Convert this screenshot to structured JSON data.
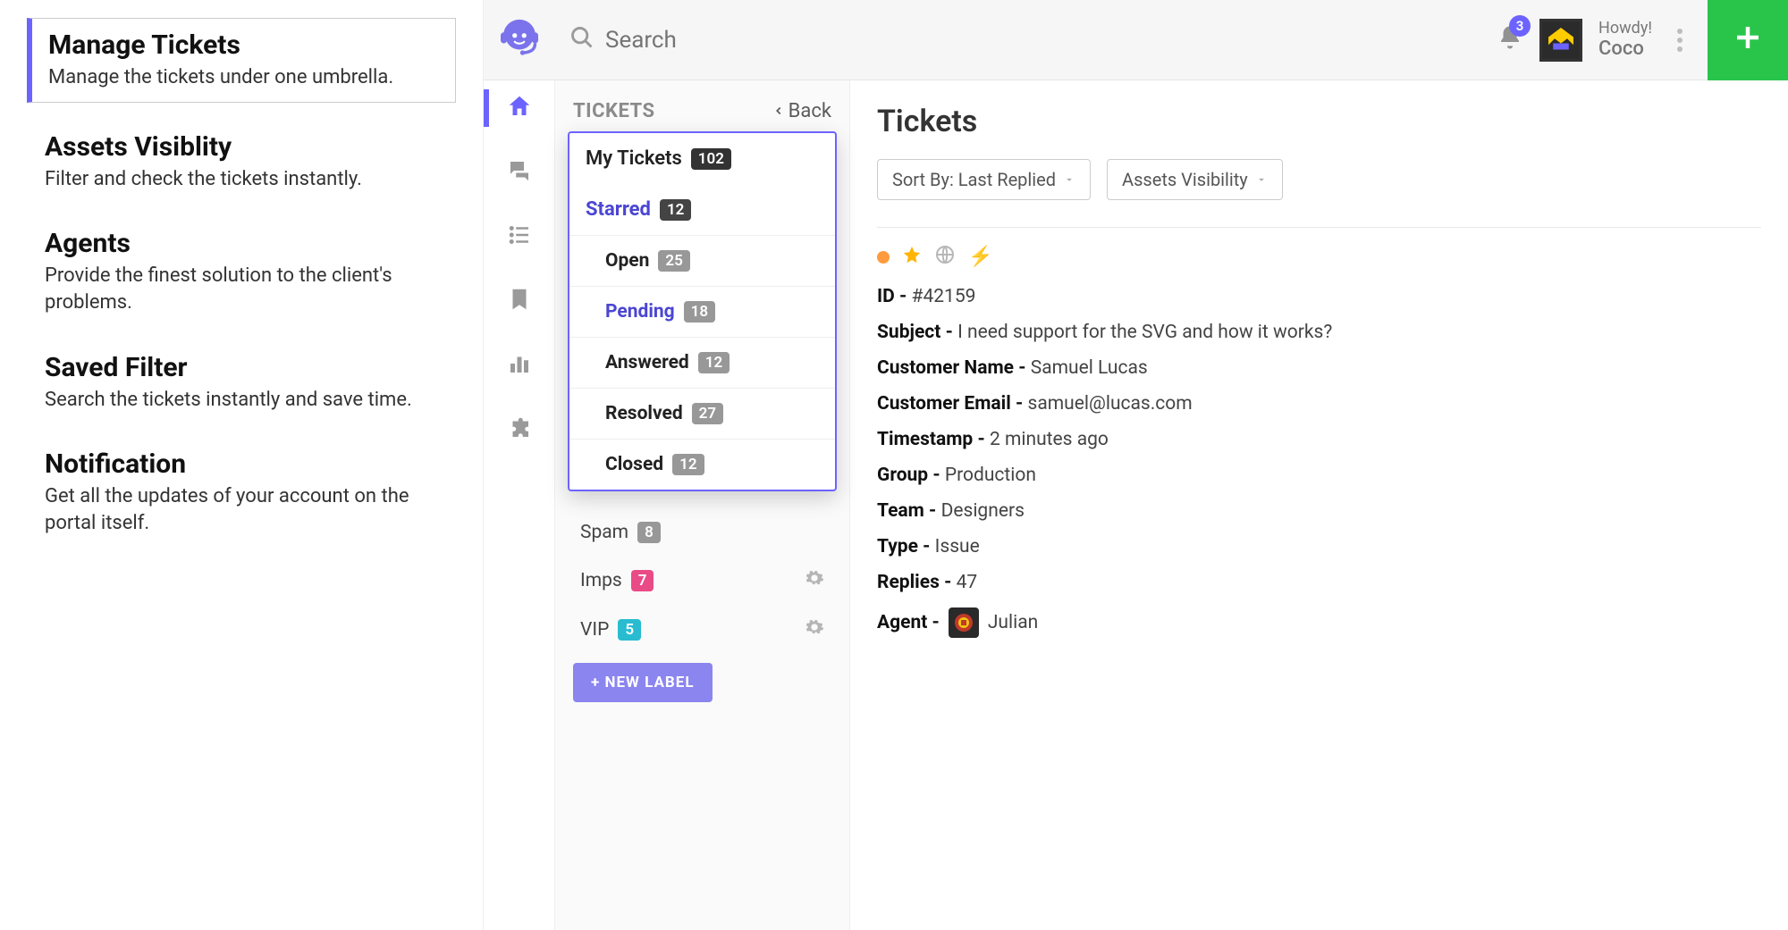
{
  "features": [
    {
      "title": "Manage Tickets",
      "desc": "Manage the tickets under one umbrella."
    },
    {
      "title": "Assets Visiblity",
      "desc": "Filter and check the tickets instantly."
    },
    {
      "title": "Agents",
      "desc": "Provide the finest solution to the client's problems."
    },
    {
      "title": "Saved Filter",
      "desc": "Search the tickets instantly and save time."
    },
    {
      "title": "Notification",
      "desc": "Get all the updates of your account on the portal itself."
    }
  ],
  "topbar": {
    "search_placeholder": "Search",
    "notifications_count": "3",
    "greeting": "Howdy!",
    "username": "Coco"
  },
  "ticketSide": {
    "title": "TICKETS",
    "back": "Back",
    "my_tickets_label": "My Tickets",
    "my_tickets_count": "102",
    "starred_label": "Starred",
    "starred_count": "12",
    "subs": [
      {
        "label": "Open",
        "count": "25"
      },
      {
        "label": "Pending",
        "count": "18"
      },
      {
        "label": "Answered",
        "count": "12"
      },
      {
        "label": "Resolved",
        "count": "27"
      },
      {
        "label": "Closed",
        "count": "12"
      }
    ],
    "spam_label": "Spam",
    "spam_count": "8",
    "imps_label": "Imps",
    "imps_count": "7",
    "vip_label": "VIP",
    "vip_count": "5",
    "new_label_btn": "+ NEW LABEL"
  },
  "ticketMain": {
    "header": "Tickets",
    "sort_label": "Sort By: Last Replied",
    "assets_label": "Assets Visibility",
    "fields": {
      "id_label": "ID - ",
      "id_value": "#42159",
      "subject_label": "Subject - ",
      "subject_value": "I need support for the SVG and how it works?",
      "customer_name_label": "Customer Name - ",
      "customer_name_value": "Samuel Lucas",
      "customer_email_label": "Customer Email - ",
      "customer_email_value": "samuel@lucas.com",
      "timestamp_label": "Timestamp - ",
      "timestamp_value": "2 minutes ago",
      "group_label": "Group - ",
      "group_value": "Production",
      "team_label": "Team - ",
      "team_value": "Designers",
      "type_label": "Type - ",
      "type_value": "Issue",
      "replies_label": "Replies - ",
      "replies_value": "47",
      "agent_label": "Agent - ",
      "agent_value": "Julian"
    }
  }
}
